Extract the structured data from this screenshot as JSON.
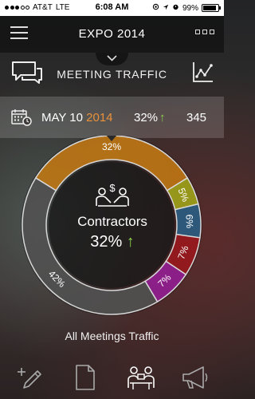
{
  "status_bar": {
    "carrier": "AT&T",
    "network": "LTE",
    "time": "6:08 AM",
    "battery": "99%"
  },
  "header": {
    "title": "EXPO 2014"
  },
  "section": {
    "title": "MEETING TRAFFIC"
  },
  "date_row": {
    "date": "MAY 10",
    "year": "2014",
    "percent": "32%",
    "trend_arrow": "↑",
    "count": "345"
  },
  "chart_data": {
    "type": "pie",
    "categories": [
      "Contractors",
      "",
      "",
      "",
      "",
      ""
    ],
    "values": [
      32,
      5,
      6,
      7,
      7,
      42
    ],
    "labels": [
      "32%",
      "5%",
      "6%",
      "7%",
      "7%",
      "42%"
    ],
    "colors": [
      "#c97d14",
      "#a7ab1a",
      "#2b6389",
      "#a1191e",
      "#9a1f9a",
      "#555555"
    ]
  },
  "center": {
    "name": "Contractors",
    "percent": "32%",
    "trend_arrow": "↑"
  },
  "footer_label": "All Meetings Traffic",
  "nav": {
    "items": [
      "edit-icon",
      "document-icon",
      "meeting-people-icon",
      "megaphone-icon"
    ]
  },
  "colors": {
    "accent_orange": "#e8913a",
    "trend_green": "#8bd14a"
  }
}
